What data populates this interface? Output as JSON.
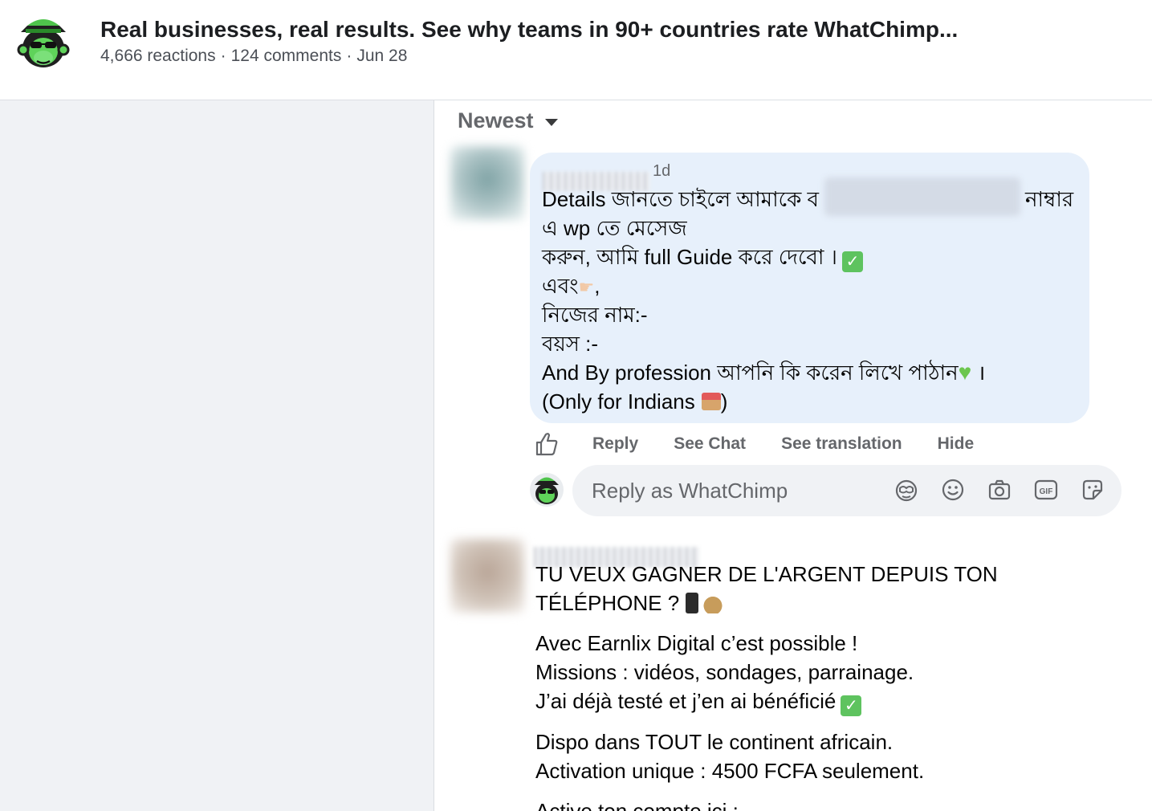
{
  "header": {
    "title": "Real businesses, real results. See why teams in 90+ countries rate WhatChimp...",
    "reactions": "4,666 reactions",
    "comments": "124 comments",
    "date": "Jun 28"
  },
  "comments_panel": {
    "sort_label": "Newest"
  },
  "comment_1": {
    "timestamp": "1d",
    "line_1_start": "Details জানতে চাইলে আমাকে ব",
    "line_1_end": "নাম্বার",
    "line_2": "এ wp তে মেসেজ",
    "line_3": "করুন, আমি full Guide করে দেবো ।",
    "line_4": "এবং",
    "line_4_tail": ",",
    "line_5": "নিজের নাম:-",
    "line_6": "বয়স :-",
    "line_7": "And By profession আপনি কি করেন লিখে পাঠান",
    "line_7_tail": "।",
    "line_8_start": "(Only for Indians",
    "line_8_end": ")"
  },
  "actions": {
    "reply": "Reply",
    "see_chat": "See Chat",
    "see_translation": "See translation",
    "hide": "Hide"
  },
  "composer": {
    "placeholder": "Reply as WhatChimp",
    "icons": [
      "avatar-sticker-icon",
      "emoji-icon",
      "camera-icon",
      "gif-icon",
      "sticker-icon"
    ]
  },
  "comment_2": {
    "p1_l1": "TU VEUX GAGNER DE L'ARGENT DEPUIS TON",
    "p1_l2": "TÉLÉPHONE ?",
    "p2_l1": "Avec Earnlix Digital c’est possible !",
    "p2_l2": "Missions : vidéos, sondages, parrainage.",
    "p2_l3": "J’ai déjà testé et j’en ai bénéficié",
    "p3_l1": "Dispo dans TOUT le continent africain.",
    "p3_l2": "Activation unique : 4500 FCFA seulement.",
    "p4_l1": "Active ton compte ici :"
  },
  "colors": {
    "brand_green": "#5fd35a",
    "bubble_bg": "#e7f0fb",
    "secondary_text": "#65676b"
  }
}
